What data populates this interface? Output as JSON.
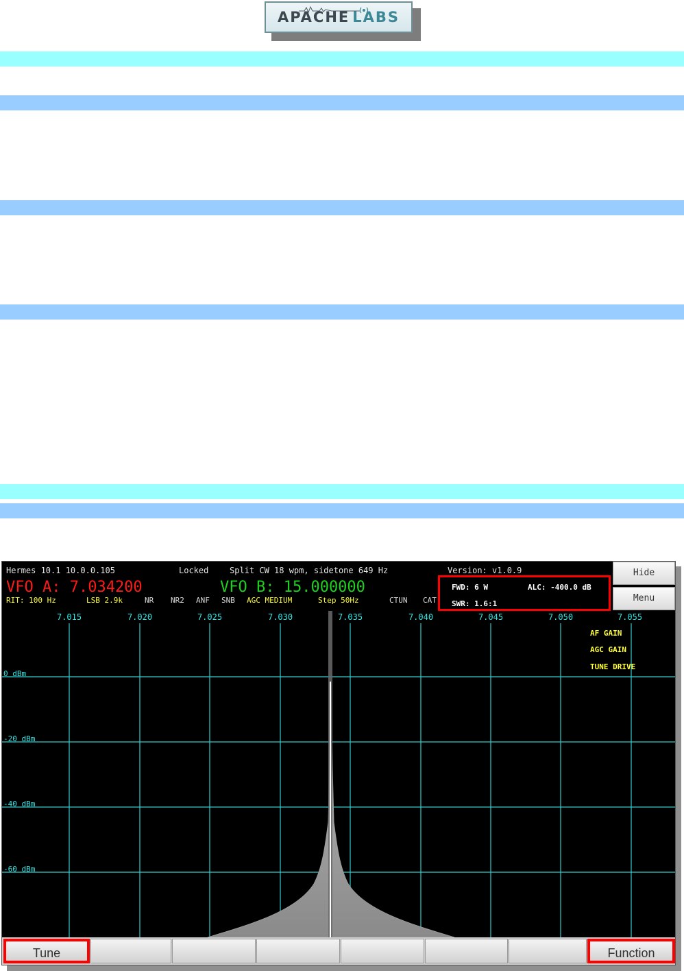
{
  "logo": {
    "main": "APACHE",
    "labs": "LABS"
  },
  "radio": {
    "status": {
      "device": "Hermes 10.1 10.0.0.105",
      "locked": "Locked",
      "mode": "Split CW 18 wpm, sidetone 649 Hz",
      "version": "Version: v1.0.9"
    },
    "vfo_a": "VFO A: 7.034200",
    "vfo_b": "VFO B: 15.000000",
    "flags": {
      "rit": "RIT: 100 Hz",
      "mode": "LSB 2.9k",
      "nr": "NR",
      "nr2": "NR2",
      "anf": "ANF",
      "snb": "SNB",
      "agc": "AGC MEDIUM",
      "step": "Step 50Hz",
      "ctun": "CTUN",
      "cat": "CAT"
    },
    "meter": {
      "fwd": "FWD: 6 W",
      "alc": "ALC: -400.0 dB",
      "swr": "SWR: 1.6:1"
    },
    "side_buttons": {
      "hide": "Hide",
      "menu": "Menu"
    },
    "freq_ticks": [
      "7.015",
      "7.020",
      "7.025",
      "7.030",
      "7.035",
      "7.040",
      "7.045",
      "7.050",
      "7.055"
    ],
    "db_ticks": [
      "0 dBm",
      "-20 dBm",
      "-40 dBm",
      "-60 dBm"
    ],
    "panel_labels": [
      "AF GAIN",
      "AGC GAIN",
      "TUNE DRIVE"
    ],
    "bottom_buttons": [
      "Tune",
      "",
      "",
      "",
      "",
      "",
      "",
      "Function"
    ]
  },
  "colors": {
    "cyan_bar": "#99ffff",
    "blue_bar": "#99ccff",
    "vfo_a": "#ff1a1a",
    "vfo_b": "#1fd11f",
    "grid": "#33cccc",
    "highlight": "#ff0000"
  }
}
